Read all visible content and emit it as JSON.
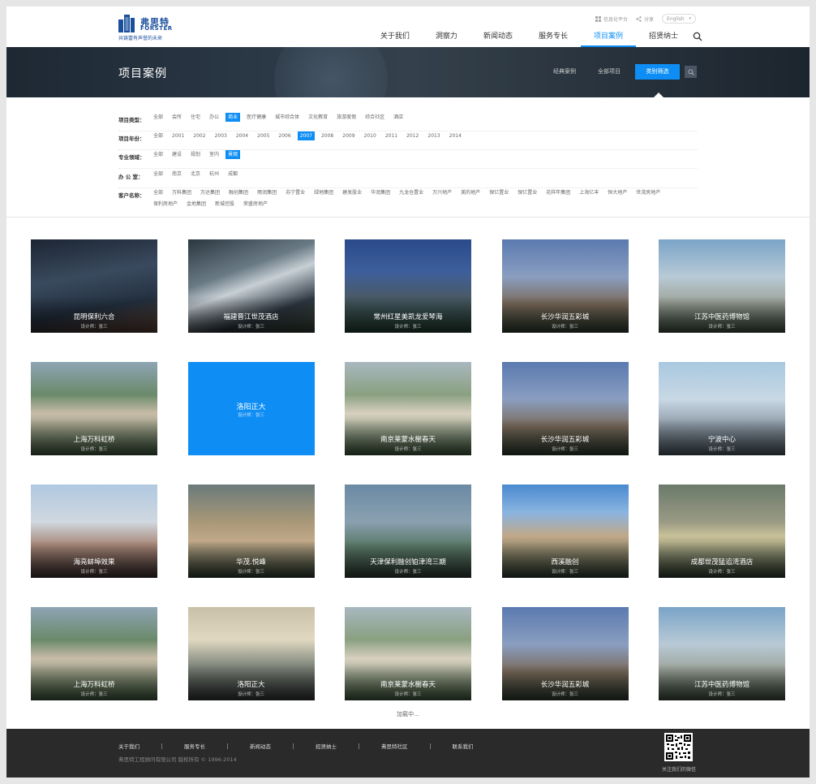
{
  "logo": {
    "cn": "弗思特",
    "en": "FORSTER",
    "slogan": "共铸富有声誉的未来"
  },
  "topbar": {
    "platform": "信息化平台",
    "share": "分享",
    "lang": "English"
  },
  "nav": [
    "关于我们",
    "洞察力",
    "新闻动态",
    "服务专长",
    "项目案例",
    "招贤纳士"
  ],
  "banner": {
    "title": "项目案例",
    "tabs": [
      "经典案例",
      "全部项目",
      "类别筛选"
    ]
  },
  "filters": [
    {
      "label": "项目类型：",
      "options": [
        "全部",
        "会所",
        "住宅",
        "办公",
        "商业",
        "医疗健康",
        "城市综合体",
        "文化教育",
        "旅游度假",
        "综合社区",
        "酒店"
      ],
      "active": 4
    },
    {
      "label": "项目年份：",
      "options": [
        "全部",
        "2001",
        "2002",
        "2003",
        "2004",
        "2005",
        "2006",
        "2007",
        "2008",
        "2009",
        "2010",
        "2011",
        "2012",
        "2013",
        "2014"
      ],
      "active": 7
    },
    {
      "label": "专业领域：",
      "options": [
        "全部",
        "建设",
        "规划",
        "室内",
        "景观"
      ],
      "active": 4
    },
    {
      "label": "办 公 室：",
      "options": [
        "全部",
        "南京",
        "北京",
        "杭州",
        "成都"
      ],
      "active": -1
    },
    {
      "label": "客户名称：",
      "options": [
        "全部",
        "万科集团",
        "万达集团",
        "融创集团",
        "雨润集团",
        "苏宁置业",
        "绿地集团",
        "建发股业",
        "华润集团",
        "九龙仓置业",
        "万兴地产",
        "美的地产",
        "保亿置业",
        "保亿置业",
        "花样年集团",
        "上海亿丰",
        "恒大地产",
        "世茂房地产",
        "保利房地产",
        "金地集团",
        "新城控股",
        "荣盛房地产"
      ],
      "active": -1
    }
  ],
  "projects": [
    {
      "title": "昆明保利六合",
      "designer": "设计师：张三",
      "bg": "linear-gradient(170deg,#1c2533 0%,#3a4a5e 40%,#233040 70%,#6a4a3a 100%)"
    },
    {
      "title": "福建晋江世茂酒店",
      "designer": "设计师：张三",
      "bg": "linear-gradient(160deg,#2a3640 0%,#6a7a85 35%,#c8d0d6 50%,#2e3842 75%,#3f4a3a 100%)"
    },
    {
      "title": "常州红星美凯龙爱琴海",
      "designer": "设计师：张三",
      "bg": "linear-gradient(180deg,#2a4a8a 0%,#3d5f9a 35%,#4a5a6a 60%,#2a4a3a 100%)"
    },
    {
      "title": "长沙华润五彩城",
      "designer": "设计师：张三",
      "bg": "linear-gradient(180deg,#5a7ab0 0%,#8a9ec0 40%,#7a6a5a 70%,#3a4a3a 100%)"
    },
    {
      "title": "江苏中医药博物馆",
      "designer": "设计师：张三",
      "bg": "linear-gradient(180deg,#7aa4c8 0%,#b8cad6 40%,#a0a8a0 65%,#4a5a4a 100%)"
    },
    {
      "title": "上海万科虹桥",
      "designer": "设计师：张三",
      "bg": "linear-gradient(180deg,#8ea4b4 0%,#6a8a6a 35%,#c8bca8 55%,#4a6a4a 100%)"
    },
    {
      "title": "洛阳正大",
      "designer": "设计师：张三",
      "bg": "#0e8ef5",
      "hover": true
    },
    {
      "title": "南京莱蒙水榭春天",
      "designer": "设计师：张三",
      "bg": "linear-gradient(180deg,#a8b8c0 0%,#8aa080 35%,#d8d0c0 55%,#4a6a4a 100%)"
    },
    {
      "title": "长沙华润五彩城",
      "designer": "设计师：张三",
      "bg": "linear-gradient(180deg,#5a7ab0 0%,#8a9ec0 40%,#7a6a5a 70%,#3a4a3a 100%)"
    },
    {
      "title": "宁波中心",
      "designer": "设计师：张三",
      "bg": "linear-gradient(180deg,#a8c8e0 0%,#c8d8e4 40%,#8a98a4 70%,#5a6a74 100%)"
    },
    {
      "title": "海亮蚌埠效果",
      "designer": "设计师：张三",
      "bg": "linear-gradient(180deg,#b0c8e0 0%,#d0d8e0 40%,#a88878 65%,#4a3a3a 100%)"
    },
    {
      "title": "华茂.悦峰",
      "designer": "设计师：张三",
      "bg": "linear-gradient(180deg,#6a7a7a 0%,#a89878 40%,#c0a888 60%,#3a4a3a 100%)"
    },
    {
      "title": "天津保利融创铂津湾三期",
      "designer": "设计师：张三",
      "bg": "linear-gradient(180deg,#6a8aa4 0%,#8aa0b0 40%,#5a7a6a 65%,#3a4a40 100%)"
    },
    {
      "title": "西溪融创",
      "designer": "设计师：张三",
      "bg": "linear-gradient(180deg,#4a8ad0 0%,#8ab4e0 30%,#c0a888 55%,#3a4a3a 100%)"
    },
    {
      "title": "成都世茂猛追湾酒店",
      "designer": "设计师：张三",
      "bg": "linear-gradient(180deg,#6a7a6a 0%,#9a9a84 40%,#c8c098 55%,#3a4a3a 100%)"
    },
    {
      "title": "上海万科虹桥",
      "designer": "设计师：张三",
      "bg": "linear-gradient(180deg,#8ea4b4 0%,#6a8a6a 35%,#c8bca8 55%,#4a6a4a 100%)"
    },
    {
      "title": "洛阳正大",
      "designer": "设计师：张三",
      "bg": "linear-gradient(180deg,#c8c0a8 0%,#e0d8c0 35%,#8a9084 60%,#3a4040 100%)"
    },
    {
      "title": "南京莱蒙水榭春天",
      "designer": "设计师：张三",
      "bg": "linear-gradient(180deg,#a8b8c0 0%,#8aa080 35%,#d8d0c0 55%,#4a6a4a 100%)"
    },
    {
      "title": "长沙华润五彩城",
      "designer": "设计师：张三",
      "bg": "linear-gradient(180deg,#5a7ab0 0%,#8a9ec0 40%,#7a6a5a 70%,#3a4a3a 100%)"
    },
    {
      "title": "江苏中医药博物馆",
      "designer": "设计师：张三",
      "bg": "linear-gradient(180deg,#7aa4c8 0%,#b8cad6 40%,#a0a8a0 65%,#4a5a4a 100%)"
    }
  ],
  "loading": "加载中...",
  "footer": {
    "links": [
      "关于我们",
      "服务专长",
      "新闻动态",
      "招贤纳士",
      "弗思特社区",
      "联系我们"
    ],
    "copyright": "弗思特工程顾问有限公司 版权所有 © 1996-2014",
    "qr_caption": "关注我们的微信"
  },
  "colors": {
    "accent": "#0e8ef5",
    "brand": "#1a4f9c",
    "footer": "#2a2a2a"
  }
}
